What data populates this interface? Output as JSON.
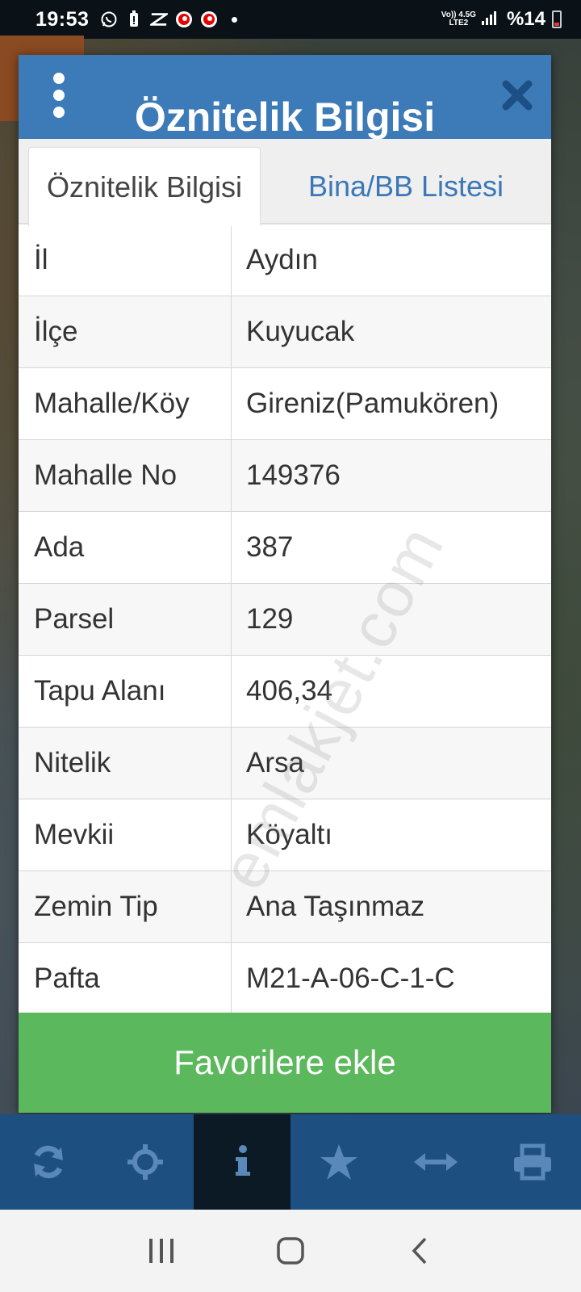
{
  "status_bar": {
    "time": "19:53",
    "network_top": "Vo)) 4.5G",
    "network_bottom": "LTE2",
    "battery": "%14"
  },
  "dialog": {
    "title": "Öznitelik Bilgisi",
    "tabs": [
      {
        "label": "Öznitelik Bilgisi",
        "active": true
      },
      {
        "label": "Bina/BB Listesi",
        "active": false
      }
    ],
    "rows": [
      {
        "key": "İl",
        "value": "Aydın"
      },
      {
        "key": "İlçe",
        "value": "Kuyucak"
      },
      {
        "key": "Mahalle/Köy",
        "value": "Gireniz(Pamukören)"
      },
      {
        "key": "Mahalle No",
        "value": "149376"
      },
      {
        "key": "Ada",
        "value": "387"
      },
      {
        "key": "Parsel",
        "value": "129"
      },
      {
        "key": "Tapu Alanı",
        "value": "406,34"
      },
      {
        "key": "Nitelik",
        "value": "Arsa"
      },
      {
        "key": "Mevkii",
        "value": "Köyaltı"
      },
      {
        "key": "Zemin Tip",
        "value": "Ana Taşınmaz"
      },
      {
        "key": "Pafta",
        "value": "M21-A-06-C-1-C"
      }
    ],
    "favorite_button": "Favorilere ekle"
  },
  "watermark": "emlakjet.com",
  "toolbar": {
    "items": [
      "refresh-icon",
      "locate-icon",
      "info-icon",
      "star-icon",
      "measure-icon",
      "print-icon"
    ],
    "active": "info-icon"
  },
  "colors": {
    "header": "#3d7ab8",
    "tab_link": "#3b78b8",
    "favorite": "#5cb85c",
    "toolbar": "#1d4f80"
  }
}
